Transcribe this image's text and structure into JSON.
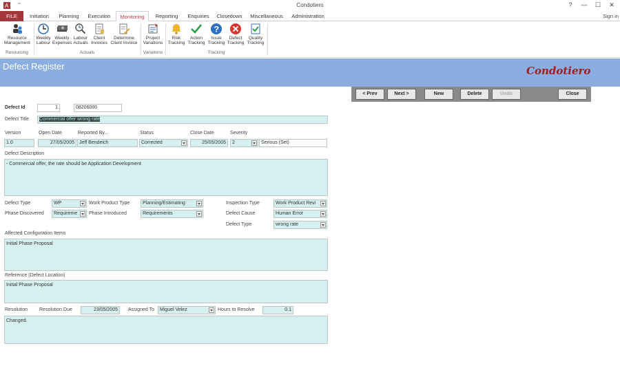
{
  "window": {
    "title": "Condotiero",
    "help": "?",
    "minimize": "—",
    "maximize": "☐",
    "close": "✕",
    "quick_access": "⁼"
  },
  "tabs": [
    "FILE",
    "Initiation",
    "Planning",
    "Execution",
    "Monitoring",
    "Reporting",
    "Enquiries",
    "Closedown",
    "Miscellaneous",
    "Administration"
  ],
  "signin": "Sign in",
  "ribbon": {
    "buttons": [
      {
        "l1": "Resource",
        "l2": "Management"
      },
      {
        "l1": "Weekly",
        "l2": "Labour"
      },
      {
        "l1": "Weekly",
        "l2": "Expenses"
      },
      {
        "l1": "Labour",
        "l2": "Actuals"
      },
      {
        "l1": "Client",
        "l2": "Invoices"
      },
      {
        "l1": "Determine",
        "l2": "Client Invoice"
      },
      {
        "l1": "Project",
        "l2": "Variations"
      },
      {
        "l1": "Risk",
        "l2": "Tracking"
      },
      {
        "l1": "Action",
        "l2": "Tracking"
      },
      {
        "l1": "Issue",
        "l2": "Tracking"
      },
      {
        "l1": "Defect",
        "l2": "Tracking"
      },
      {
        "l1": "Quality",
        "l2": "Tracking"
      }
    ],
    "groups": [
      "Resourcing",
      "Actuals",
      "Variations",
      "Tracking"
    ]
  },
  "form": {
    "title": "Defect Register",
    "brand": "Condotiero",
    "nav": {
      "prev": "< Prev",
      "next": "Next >",
      "new": "New",
      "delete": "Delete",
      "undo": "Undo",
      "close": "Close"
    },
    "labels": {
      "defect_id": "Defect Id",
      "defect_title": "Defect Title",
      "version": "Version",
      "open_date": "Open Date",
      "reported_by": "Reported By...",
      "status": "Status",
      "close_date": "Close Date",
      "severity": "Severity",
      "description": "Defect Description",
      "defect_type": "Defect Type",
      "work_product_type": "Work Product Type",
      "inspection_type": "Inspection Type",
      "phase_discovered": "Phase Discovered",
      "phase_introduced": "Phase Introduced",
      "defect_cause": "Defect Cause",
      "defect_type2": "Defect Type",
      "affected_items": "Affected Configuration Items",
      "reference": "Reference (Defect Location)",
      "resolution": "Resolution",
      "resolution_due": "Resolution Due",
      "assigned_to": "Assigned To",
      "hours_to_resolve": "Hours to Resolve"
    },
    "values": {
      "defect_id": "1",
      "defect_code": "08206000",
      "defect_title": "Commercial offer wrong rate",
      "version": "1.0",
      "open_date": "27/05/2005",
      "reported_by": "Jeff Bendeich",
      "status": "Corrected",
      "close_date": "25/05/2005",
      "severity": "2",
      "severity_desc": "Serious (Set)",
      "description": "- Commercial offer, the rate should be Application Development",
      "defect_type": "WP",
      "work_product_type": "Planning/Estimating",
      "inspection_type": "Work Product Revi",
      "phase_discovered": "Requireme",
      "phase_introduced": "Requirements",
      "defect_cause": "Human Error",
      "defect_type2": "wrong rate",
      "affected_items": "Initial Phase Proposal",
      "reference": "Initial Phase Proposal",
      "resolution_due": "23/05/2005",
      "assigned_to": "Miguel Velez",
      "hours_to_resolve": "0.1",
      "resolution": "Changed."
    }
  }
}
